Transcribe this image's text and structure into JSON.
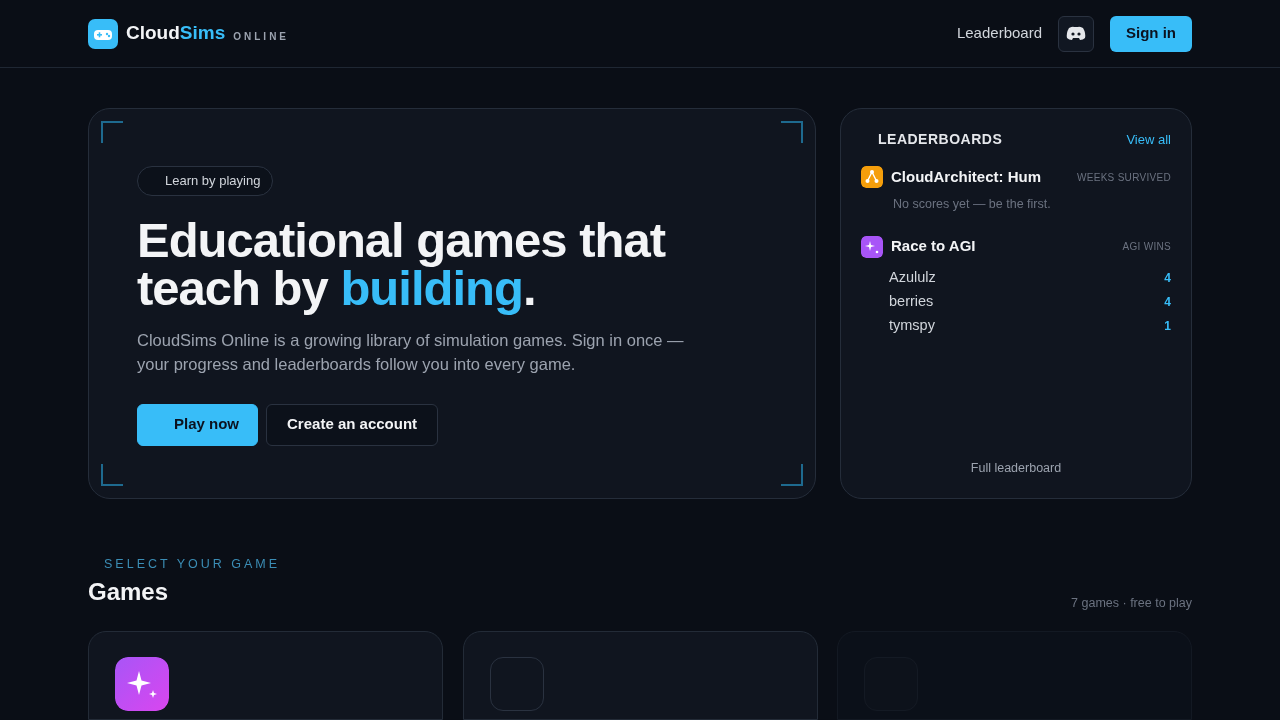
{
  "header": {
    "brand": "Cloud",
    "brand_accent": "Sims",
    "brand_suffix": "ONLINE",
    "nav_link": "Leaderboard",
    "signin": "Sign in"
  },
  "hero": {
    "pill": "Learn by playing",
    "title": "Educational games that teach by *building*.",
    "text": "CloudSims Online is a growing library of simulation games. Sign in once — your progress and leaderboards follow you into every game.",
    "buttons": [
      {
        "label": "Play now",
        "kind": "primary"
      },
      {
        "label": "Create an account",
        "kind": "secondary"
      }
    ]
  },
  "leaderboards": {
    "title": "LEADERBOARDS",
    "view_all": "View all",
    "games": [
      {
        "name": "CloudArchitect: Hum",
        "kind": "nodes",
        "color": "#f59e0b",
        "metric": "WEEKS SURVIVED",
        "empty": "No scores yet — be the first."
      },
      {
        "name": "Race to AGI",
        "kind": "sparkle",
        "color": "#a855f7",
        "metric": "AGI WINS",
        "entries": [
          {
            "player": "Azululz",
            "score": "4"
          },
          {
            "player": "berries",
            "score": "4"
          },
          {
            "player": "tymspy",
            "score": "1"
          }
        ]
      }
    ],
    "footer": "Full leaderboard"
  },
  "games_section": {
    "eyebrow": "SELECT YOUR GAME",
    "title": "Games",
    "summary": "7 games · free to play",
    "cards": [
      {
        "kind": "sparkle",
        "dimmed": false
      },
      {
        "kind": "placeholder",
        "dimmed": false
      },
      {
        "kind": "placeholder",
        "dimmed": true
      }
    ]
  }
}
